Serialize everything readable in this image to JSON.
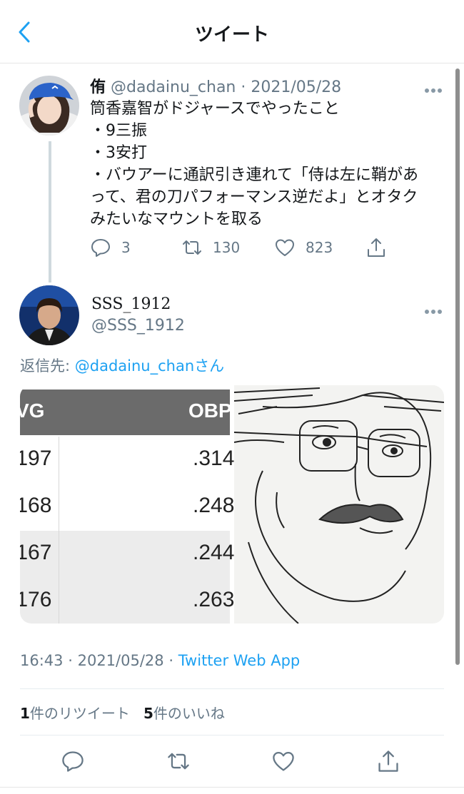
{
  "header": {
    "title": "ツイート"
  },
  "tweet1": {
    "name": "侑",
    "handle": "@dadainu_chan",
    "date": "2021/05/28",
    "lines": [
      "筒香嘉智がドジャースでやったこと",
      "・9三振",
      "・3安打",
      "・バウアーに通訳引き連れて「侍は左に鞘があ",
      "って、君の刀パフォーマンス逆だよ」とオタク",
      "みたいなマウントを取る"
    ],
    "reply_count": "3",
    "retweet_count": "130",
    "like_count": "823"
  },
  "tweet2": {
    "name": "SSS_1912",
    "handle": "@SSS_1912",
    "reply_label": "返信先: ",
    "reply_target": "@dadainu_chanさん",
    "table": {
      "headers": [
        "VG",
        "OBP"
      ],
      "rows": [
        [
          ".197",
          ".314"
        ],
        [
          ".168",
          ".248"
        ],
        [
          ".167",
          ".244"
        ],
        [
          ".176",
          ".263"
        ]
      ]
    },
    "time": "16:43",
    "date": "2021/05/28",
    "source": "Twitter Web App",
    "retweets_num": "1",
    "retweets_label": "件のリツイート",
    "likes_num": "5",
    "likes_label": "件のいいね"
  },
  "colors": {
    "accent": "#1da1f2",
    "muted": "#657786",
    "table_header": "#6b6b6b"
  }
}
